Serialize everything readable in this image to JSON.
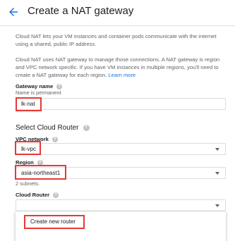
{
  "header": {
    "title": "Create a NAT gateway",
    "back_icon": "arrow-back-icon"
  },
  "intro": {
    "para1": "Cloud NAT lets your VM instances and container pods communicate with the internet using a shared, public IP address.",
    "para2_text": "Cloud NAT uses NAT gateway to manage those connections. A NAT gateway is region and VPC network specific. If you have VM instances in multiple regions, you'll need to create a NAT gateway for each region. ",
    "learn_more": "Learn more"
  },
  "gateway_name": {
    "label": "Gateway name",
    "hint": "Name is permanent",
    "value": "lk-nat"
  },
  "cloud_router_section": {
    "title": "Select Cloud Router"
  },
  "vpc_network": {
    "label": "VPC network",
    "value": "lk-vpc"
  },
  "region": {
    "label": "Region",
    "value": "asia-northeast1",
    "hint": "2 subnets."
  },
  "cloud_router": {
    "label": "Cloud Router",
    "value": ""
  },
  "router_menu": {
    "create_label": "Create new router"
  },
  "colors": {
    "accent": "#1a73e8",
    "highlight": "#e53935",
    "text": "#202124",
    "secondary_text": "#5f6368"
  },
  "help_icon": "help-icon",
  "dropdown_icon": "caret-down-icon"
}
